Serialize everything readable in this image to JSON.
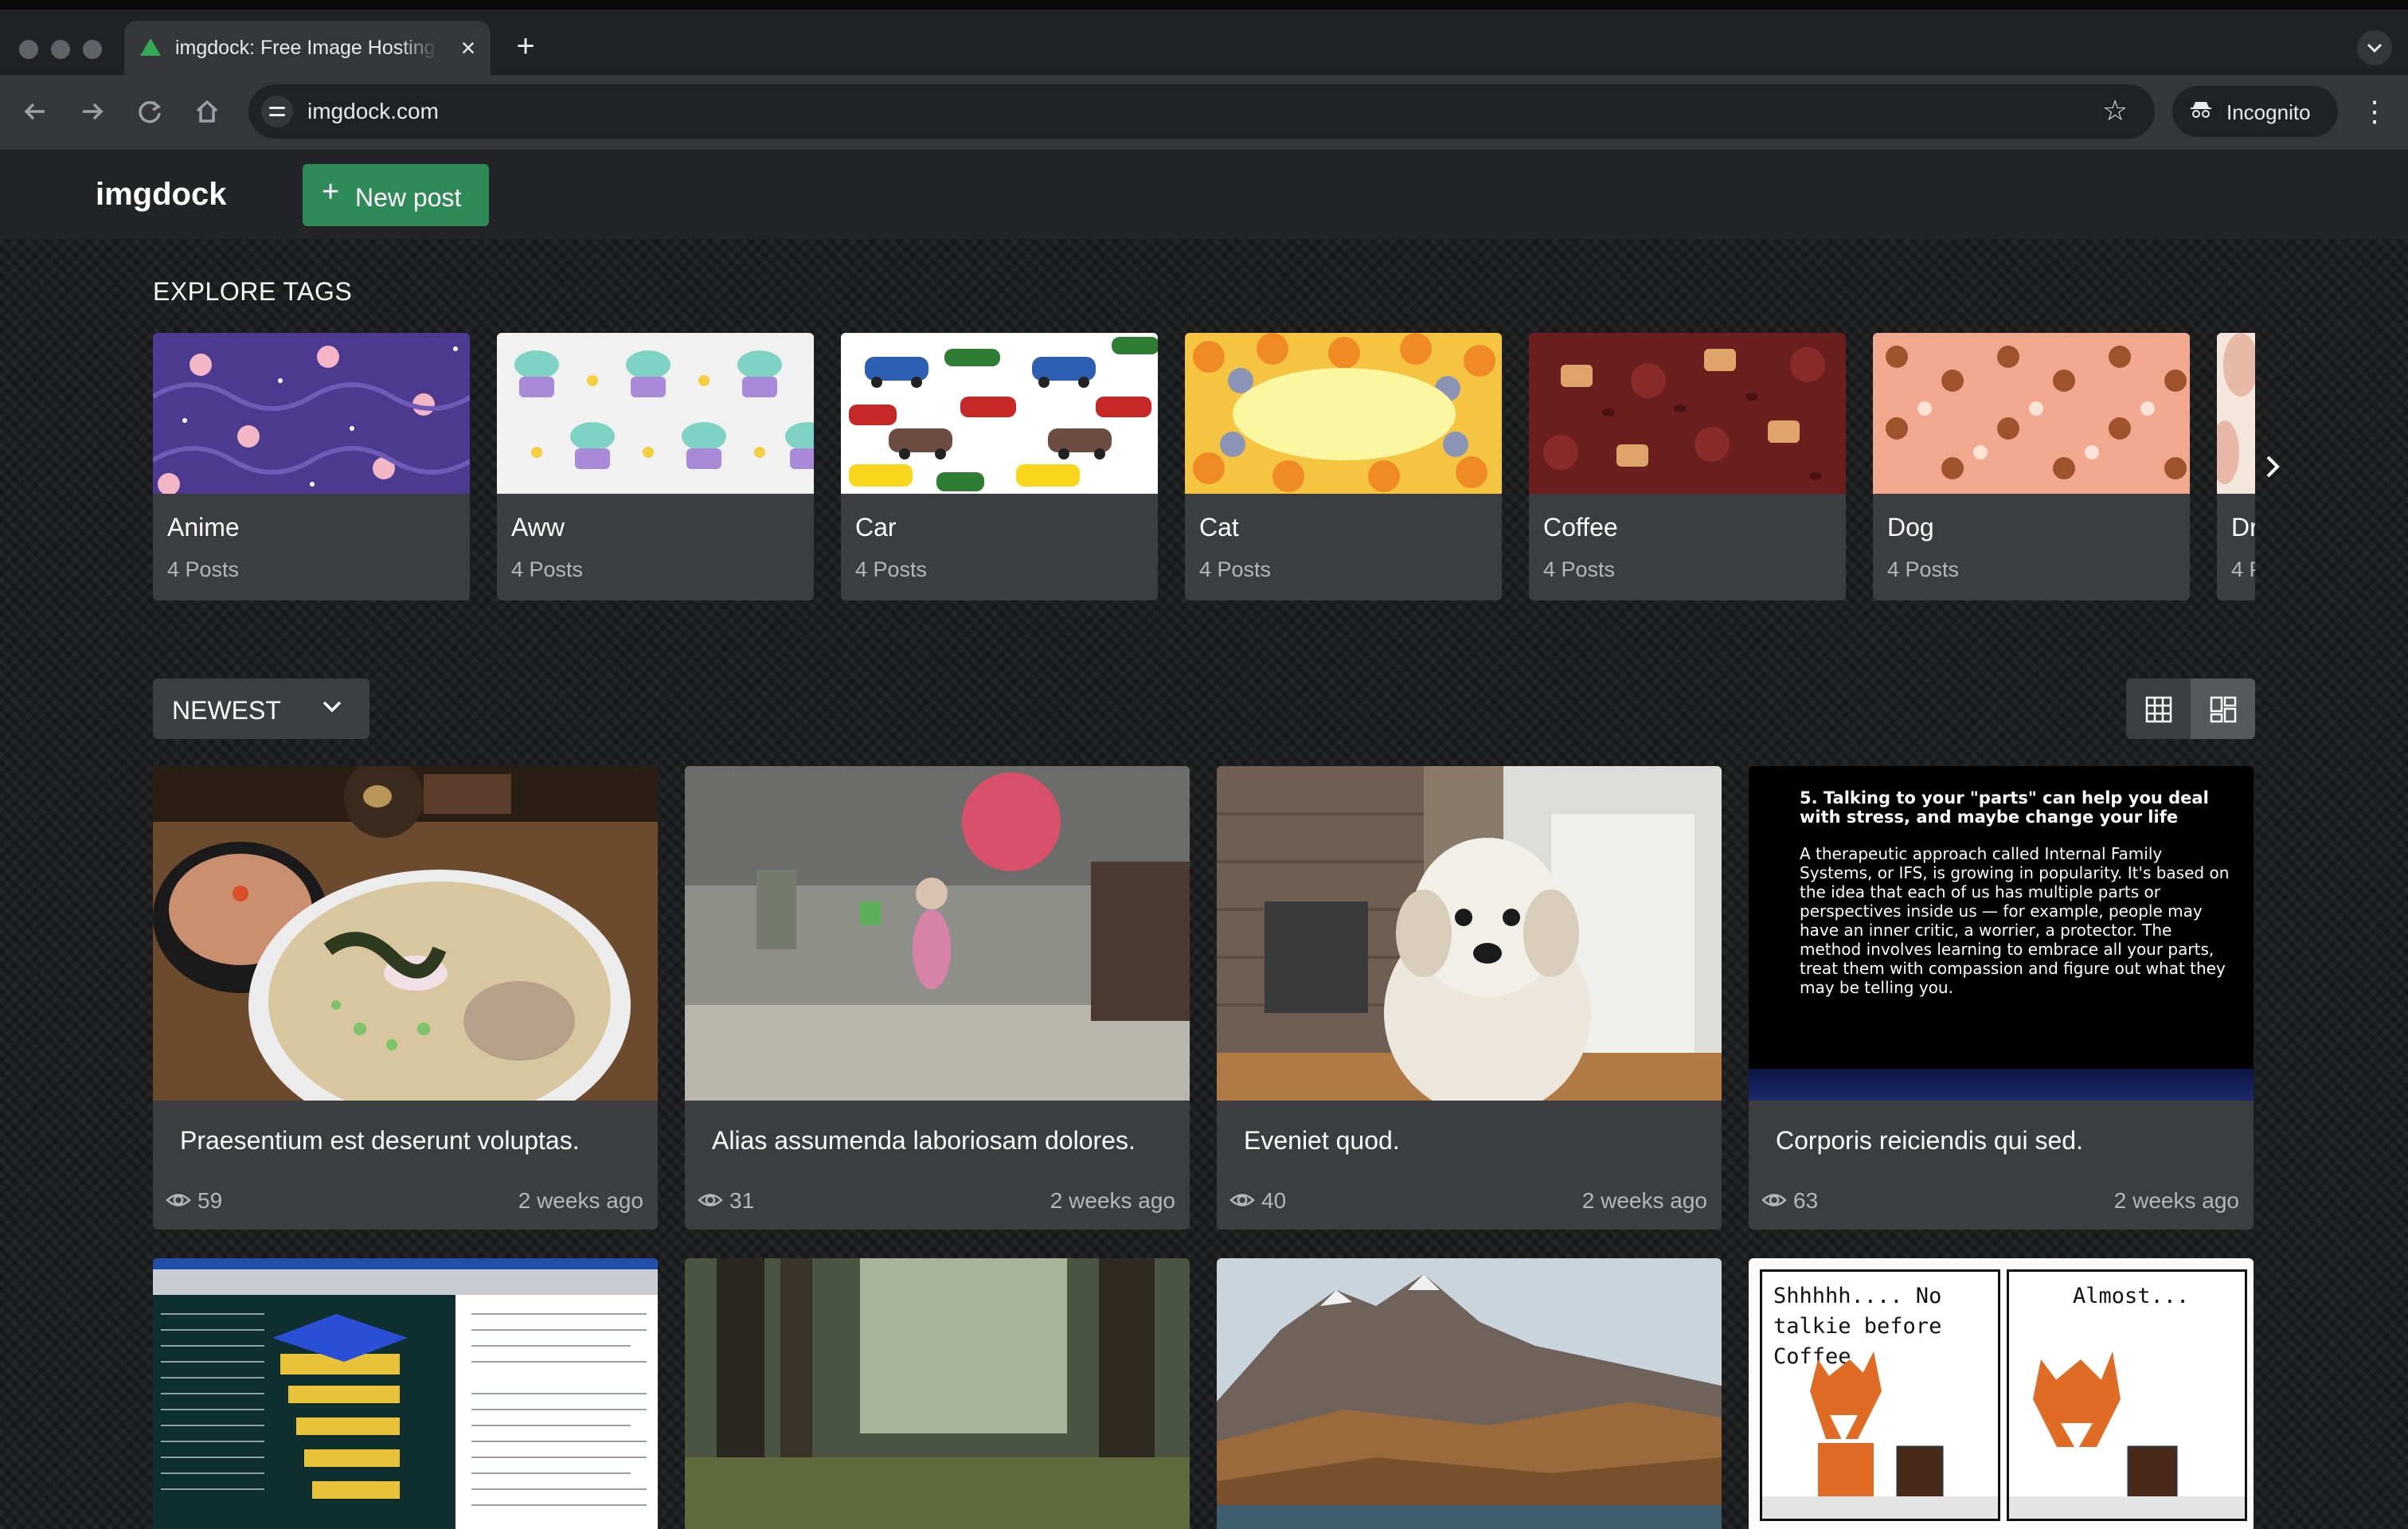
{
  "browser": {
    "tab_title": "imgdock: Free Image Hosting",
    "url": "imgdock.com",
    "incognito_label": "Incognito"
  },
  "app": {
    "logo": "imgdock",
    "new_post_label": "New post"
  },
  "explore": {
    "title": "EXPLORE TAGS",
    "tags": [
      {
        "name": "Anime",
        "count": "4 Posts"
      },
      {
        "name": "Aww",
        "count": "4 Posts"
      },
      {
        "name": "Car",
        "count": "4 Posts"
      },
      {
        "name": "Cat",
        "count": "4 Posts"
      },
      {
        "name": "Coffee",
        "count": "4 Posts"
      },
      {
        "name": "Dog",
        "count": "4 Posts"
      },
      {
        "name": "Dr",
        "count": "4 P"
      }
    ]
  },
  "sort": {
    "selected": "NEWEST"
  },
  "posts": [
    {
      "title": "Praesentium est deserunt voluptas.",
      "views": "59",
      "time": "2 weeks ago"
    },
    {
      "title": "Alias assumenda laboriosam dolores.",
      "views": "31",
      "time": "2 weeks ago"
    },
    {
      "title": "Eveniet quod.",
      "views": "40",
      "time": "2 weeks ago"
    },
    {
      "title": "Corporis reiciendis qui sed.",
      "views": "63",
      "time": "2 weeks ago"
    }
  ],
  "text_post": {
    "heading": "5. Talking to your \"parts\" can help you deal with stress, and maybe change your life",
    "body": "A therapeutic approach called Internal Family Systems, or IFS, is growing in popularity. It's based on the idea that each of us has multiple parts or perspectives inside us — for example, people may have an inner critic, a worrier, a protector. The method involves learning to embrace all your parts, treat them with compassion and figure out what they may be telling you."
  },
  "comic": {
    "panel1": "Shhhhh.... No talkie before Coffee",
    "panel2": "Almost..."
  }
}
